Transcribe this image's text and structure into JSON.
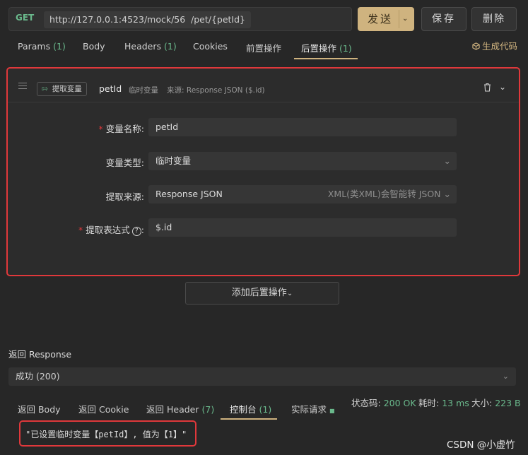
{
  "request": {
    "method": "GET",
    "url": "http://127.0.0.1:4523/mock/56",
    "path": "/pet/{petId}",
    "send_label": "发送",
    "save_label": "保存",
    "delete_label": "删除"
  },
  "tabs": [
    {
      "label": "Params",
      "count": "(1)"
    },
    {
      "label": "Body",
      "count": ""
    },
    {
      "label": "Headers",
      "count": "(1)"
    },
    {
      "label": "Cookies",
      "count": ""
    },
    {
      "label": "前置操作",
      "count": ""
    },
    {
      "label": "后置操作",
      "count": "(1)",
      "active": true
    }
  ],
  "generate_code_label": "生成代码",
  "extractor": {
    "tag_label": "提取变量",
    "variable_name": "petId",
    "scope": "临时变量",
    "source_summary": "来源: Response JSON ($.id)",
    "fields": {
      "name_label": "变量名称:",
      "name_value": "petId",
      "type_label": "变量类型:",
      "type_value": "临时变量",
      "source_label": "提取来源:",
      "source_value": "Response JSON",
      "source_hint": "XML(类XML)会智能转 JSON",
      "expr_label": "提取表达式",
      "expr_value": "$.id"
    }
  },
  "add_post_action_label": "添加后置操作",
  "response": {
    "title": "返回 Response",
    "selected": "成功 (200)",
    "tabs": [
      {
        "label": "返回 Body",
        "count": ""
      },
      {
        "label": "返回 Cookie",
        "count": ""
      },
      {
        "label": "返回 Header",
        "count": "(7)"
      },
      {
        "label": "控制台",
        "count": "(1)",
        "active": true
      },
      {
        "label": "实际请求",
        "count": ""
      }
    ],
    "status_label": "状态码:",
    "status_value": "200 OK",
    "time_label": "耗时:",
    "time_value": "13 ms",
    "size_label": "大小:",
    "size_value": "223 B",
    "console_message": "\"已设置临时变量【petId】, 值为【1】\""
  },
  "watermark": "CSDN @小虚竹",
  "colors": {
    "accent_gold": "#cfb37f",
    "accent_green": "#6ab98c",
    "highlight_red": "#e0383b",
    "background": "#272727"
  }
}
